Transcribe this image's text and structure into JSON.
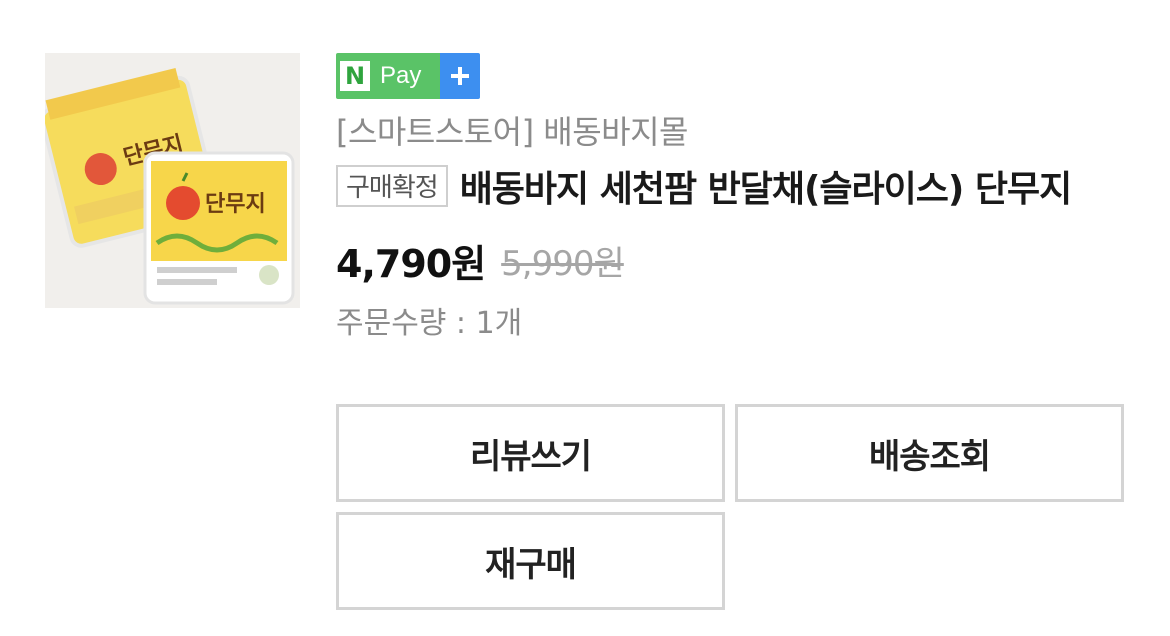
{
  "badge": {
    "npay_n": "N",
    "npay_pay": "Pay",
    "plus_icon": "plus-icon",
    "colors": {
      "green": "#5ac367",
      "blue": "#3d8ff0"
    }
  },
  "product": {
    "image_icon": "product-thumbnail",
    "seller": "[스마트스토어] 배동바지몰",
    "status": "구매확정",
    "title": "배동바지 세천팜 반달채(슬라이스) 단무지",
    "price": "4,790원",
    "original_price": "5,990원",
    "quantity": "주문수량 : 1개"
  },
  "actions": {
    "review": "리뷰쓰기",
    "track": "배송조회",
    "rebuy": "재구매"
  }
}
